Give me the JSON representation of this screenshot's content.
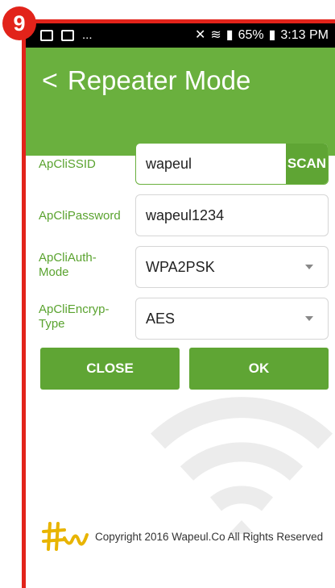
{
  "step_badge": "9",
  "status_bar": {
    "left_dots": "...",
    "right_text": "65%",
    "time": "3:13 PM"
  },
  "header": {
    "back_glyph": "<",
    "title": "Repeater Mode"
  },
  "form": {
    "ssid": {
      "label": "ApCliSSID",
      "value": "wapeul",
      "action": "SCAN"
    },
    "password": {
      "label": "ApCliPassword",
      "value": "wapeul1234"
    },
    "auth_mode": {
      "label_line1": "ApCliAuth-",
      "label_line2": "Mode",
      "value": "WPA2PSK"
    },
    "encryp_type": {
      "label_line1": "ApCliEncryp-",
      "label_line2": "Type",
      "value": "AES"
    }
  },
  "buttons": {
    "close": "CLOSE",
    "ok": "OK"
  },
  "footer": {
    "copyright": "Copyright 2016 Wapeul.Co All Rights Reserved"
  },
  "colors": {
    "accent": "#6ab03e",
    "button": "#5fa534",
    "frame": "#e2231a"
  }
}
